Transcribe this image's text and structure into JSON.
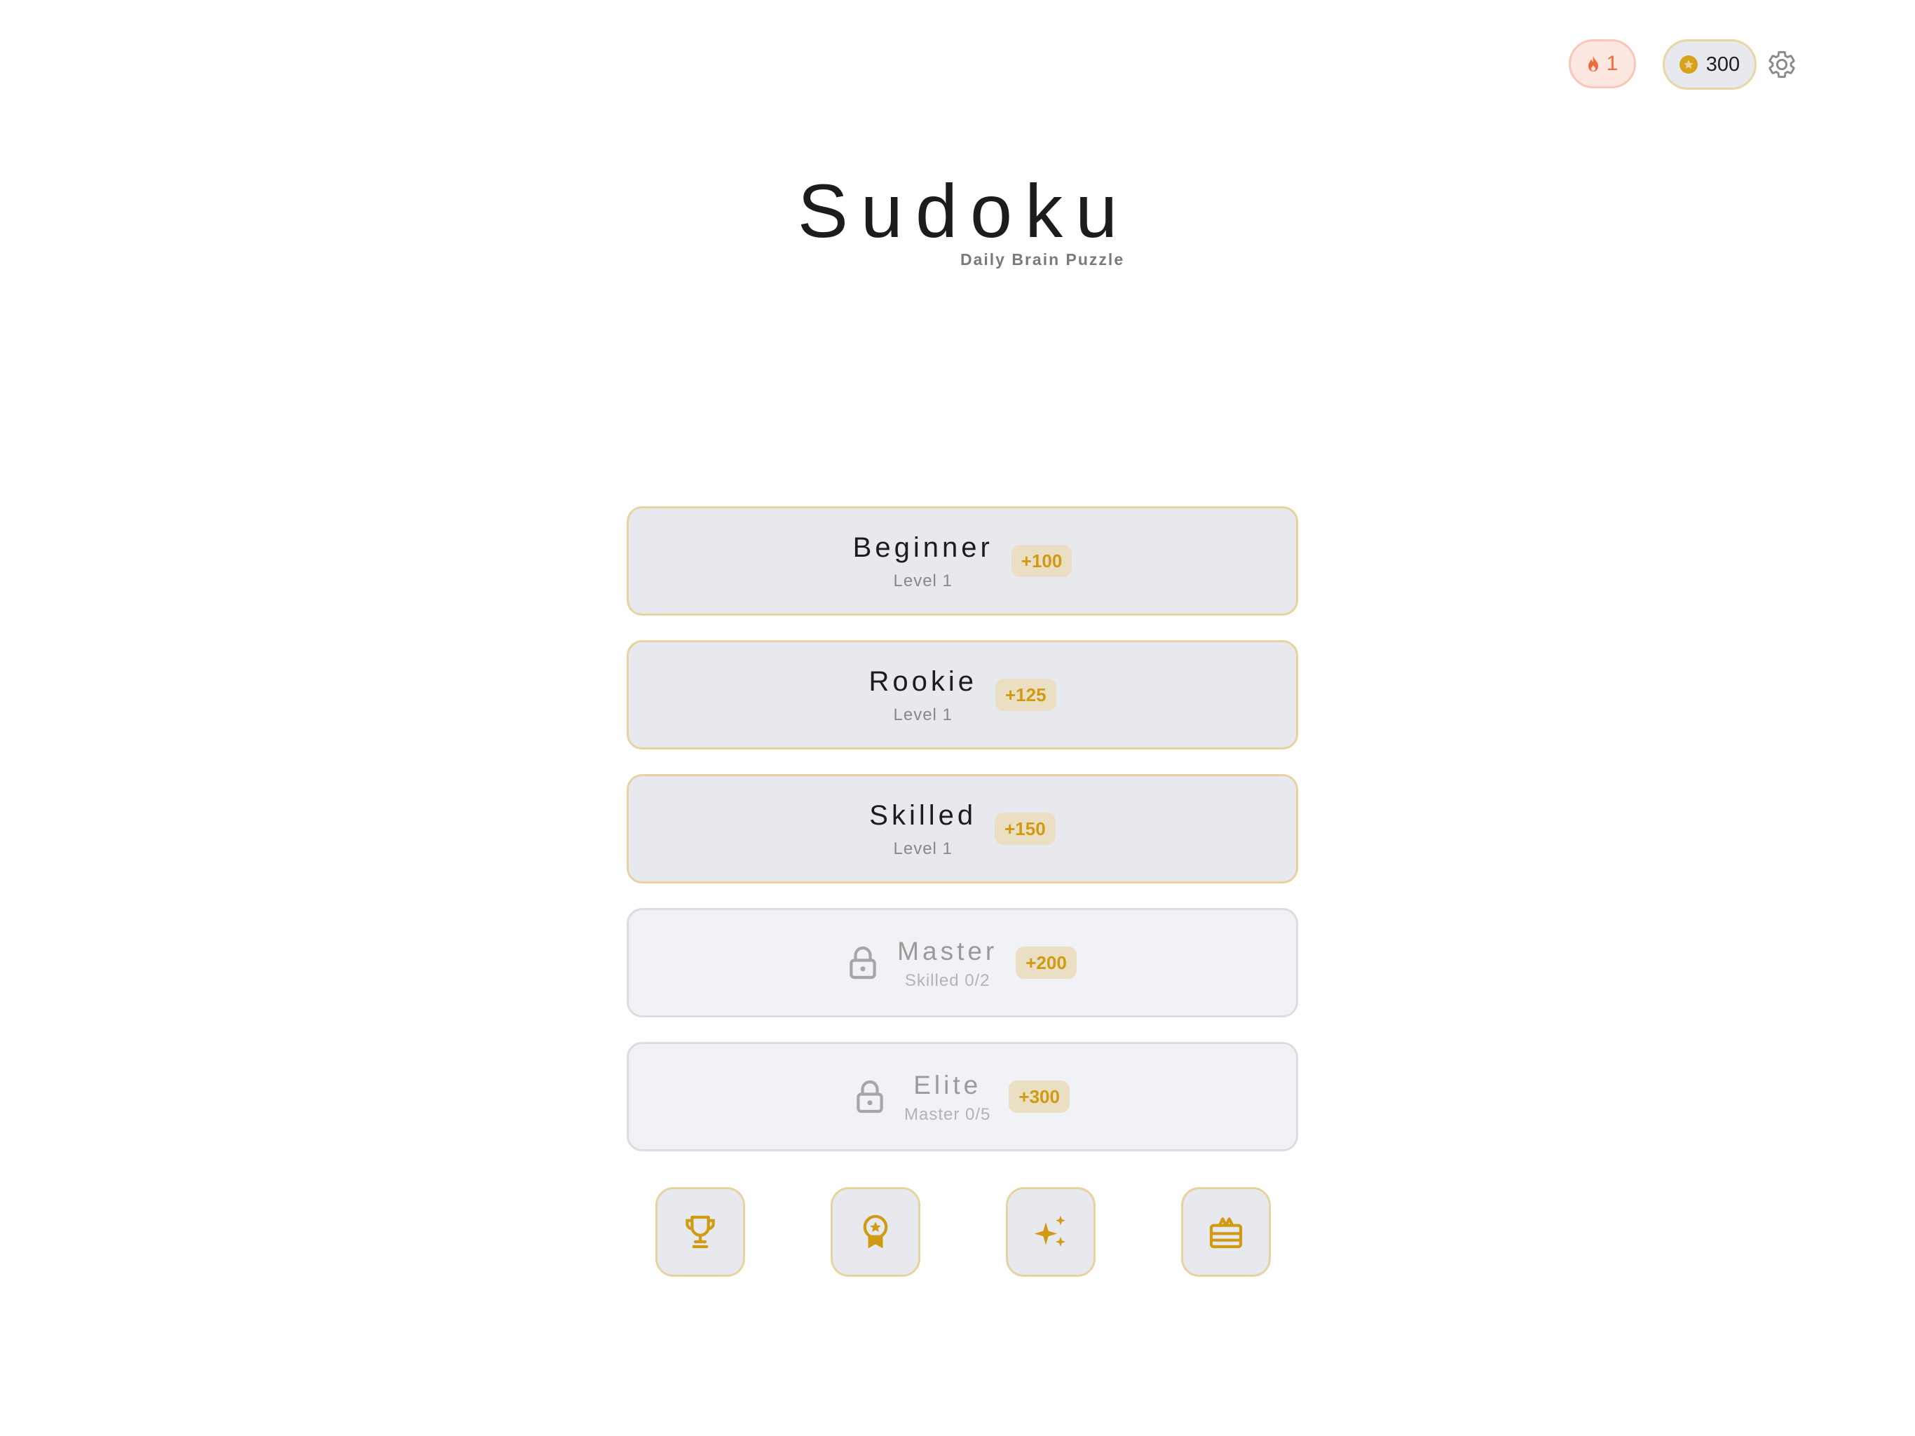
{
  "colors": {
    "accent_gold": "#d09a12",
    "streak_orange": "#ef6b3a",
    "card_bg": "#e7e9ee",
    "card_border": "#e6d3a0",
    "locked_bg": "#f1f2f5"
  },
  "header": {
    "streak": {
      "icon": "flame-icon",
      "count": "1"
    },
    "coins": {
      "icon": "coin-star-icon",
      "amount": "300"
    },
    "settings_icon": "gear-icon"
  },
  "title": {
    "main": "Sudoku",
    "subtitle": "Daily Brain Puzzle"
  },
  "levels": [
    {
      "name": "Beginner",
      "detail": "Level 1",
      "reward": "+100",
      "locked": false
    },
    {
      "name": "Rookie",
      "detail": "Level 1",
      "reward": "+125",
      "locked": false
    },
    {
      "name": "Skilled",
      "detail": "Level 1",
      "reward": "+150",
      "locked": false
    },
    {
      "name": "Master",
      "detail": "Skilled 0/2",
      "reward": "+200",
      "locked": true
    },
    {
      "name": "Elite",
      "detail": "Master 0/5",
      "reward": "+300",
      "locked": true
    }
  ],
  "bottom_nav": [
    {
      "icon": "trophy-icon"
    },
    {
      "icon": "award-badge-icon"
    },
    {
      "icon": "sparkles-icon"
    },
    {
      "icon": "gift-box-icon"
    }
  ]
}
